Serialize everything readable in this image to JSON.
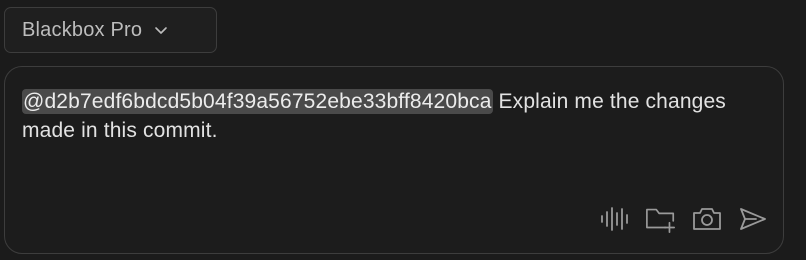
{
  "model_selector": {
    "label": "Blackbox Pro",
    "icon": "chevron-down-icon"
  },
  "composer": {
    "mention": "@d2b7edf6bdcd5b04f39a56752ebe33bff8420bca",
    "text": " Explain me the changes made in this commit.",
    "tools": [
      {
        "name": "voice-icon"
      },
      {
        "name": "add-folder-icon"
      },
      {
        "name": "camera-icon"
      },
      {
        "name": "send-icon"
      }
    ]
  },
  "colors": {
    "background": "#1b1b1b",
    "border": "#3d3d3d",
    "text": "#e2e2e2",
    "mention_bg": "#4a4a4a",
    "icon": "#9a9a9a"
  }
}
